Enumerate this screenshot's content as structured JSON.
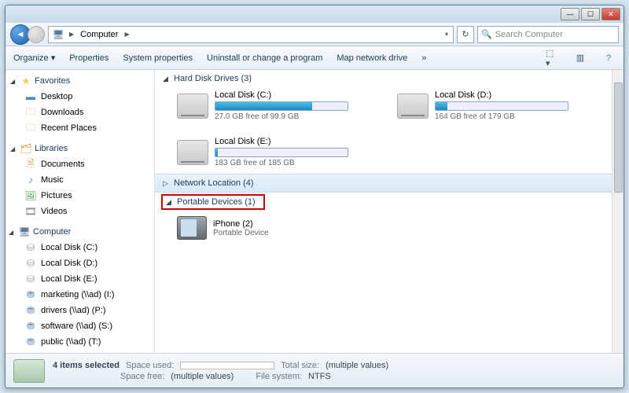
{
  "address": {
    "root_label": "Computer"
  },
  "search": {
    "placeholder": "Search Computer"
  },
  "toolbar": {
    "organize": "Organize",
    "properties": "Properties",
    "system_properties": "System properties",
    "uninstall": "Uninstall or change a program",
    "map_drive": "Map network drive",
    "more": "»"
  },
  "sidebar": {
    "favorites": {
      "label": "Favorites",
      "items": [
        "Desktop",
        "Downloads",
        "Recent Places"
      ]
    },
    "libraries": {
      "label": "Libraries",
      "items": [
        "Documents",
        "Music",
        "Pictures",
        "Videos"
      ]
    },
    "computer": {
      "label": "Computer",
      "items": [
        "Local Disk (C:)",
        "Local Disk (D:)",
        "Local Disk (E:)",
        "marketing (\\\\ad) (I:)",
        "drivers (\\\\ad) (P:)",
        "software (\\\\ad) (S:)",
        "public (\\\\ad) (T:)"
      ]
    }
  },
  "sections": {
    "hdd": {
      "label": "Hard Disk Drives (3)",
      "drives": [
        {
          "name": "Local Disk (C:)",
          "free": "27.0 GB free of 99.9 GB",
          "fill": 73
        },
        {
          "name": "Local Disk (D:)",
          "free": "164 GB free of 179 GB",
          "fill": 9
        },
        {
          "name": "Local Disk (E:)",
          "free": "183 GB free of 185 GB",
          "fill": 2
        }
      ]
    },
    "network": {
      "label": "Network Location (4)"
    },
    "portable": {
      "label": "Portable Devices (1)",
      "devices": [
        {
          "name": "iPhone (2)",
          "type": "Portable Device"
        }
      ]
    }
  },
  "status": {
    "selected": "4 items selected",
    "space_used_lbl": "Space used:",
    "space_free_lbl": "Space free:",
    "space_free_val": "(multiple values)",
    "total_size_lbl": "Total size:",
    "total_size_val": "(multiple values)",
    "fs_lbl": "File system:",
    "fs_val": "NTFS"
  }
}
